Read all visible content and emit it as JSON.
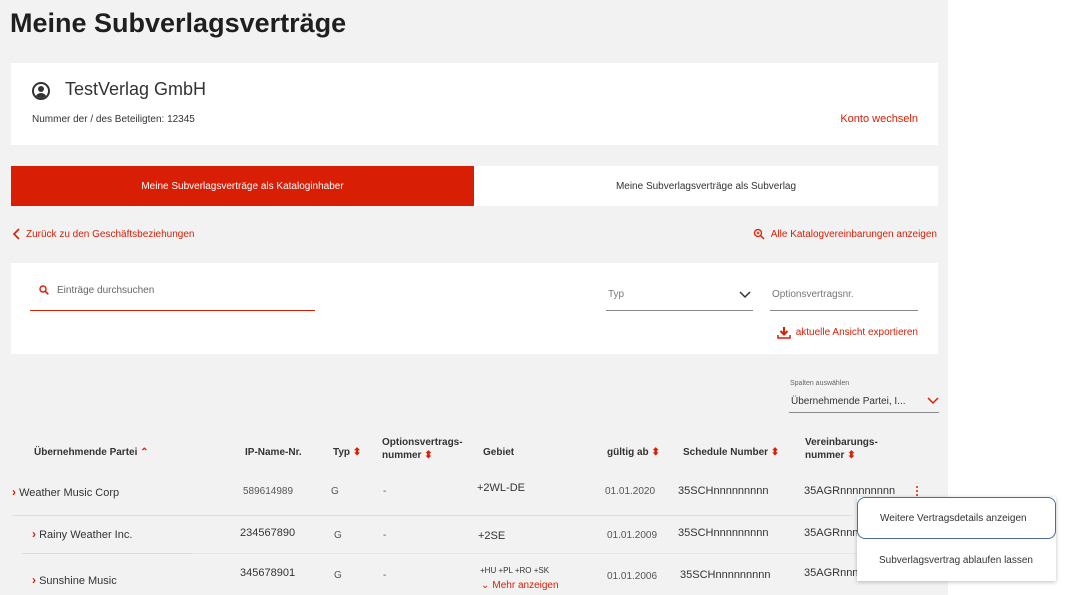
{
  "page": {
    "title": "Meine Subverlagsverträge"
  },
  "account": {
    "name": "TestVerlag GmbH",
    "number_label": "Nummer der / des Beteiligten:",
    "number_value": "12345",
    "switch_label": "Konto wechseln"
  },
  "tabs": [
    {
      "label": "Meine Subverlagsverträge als Kataloginhaber",
      "active": true
    },
    {
      "label": "Meine Subverlagsverträge als Subverlag",
      "active": false
    }
  ],
  "nav": {
    "back_label": "Zurück zu den Geschäftsbeziehungen",
    "catalog_label": "Alle Katalogvereinbarungen anzeigen"
  },
  "filters": {
    "search_placeholder": "Einträge durchsuchen",
    "typ_placeholder": "Typ",
    "option_placeholder": "Optionsvertragsnr.",
    "export_label": "aktuelle Ansicht exportieren"
  },
  "column_select": {
    "label": "Spalten auswählen",
    "value": "Übernehmende Partei, I..."
  },
  "table": {
    "headers": {
      "party": "Übernehmende Partei",
      "ip": "IP-Name-Nr.",
      "typ": "Typ",
      "option_line1": "Optionsvertrags-",
      "option_line2": "nummer",
      "region": "Gebiet",
      "valid": "gültig ab",
      "schedule": "Schedule Number",
      "agreement_line1": "Vereinbarungs-",
      "agreement_line2": "nummer"
    },
    "rows": [
      {
        "party": "Weather Music Corp",
        "ip": "589614989",
        "typ": "G",
        "option": "-",
        "region": "+2WL-DE",
        "valid": "01.01.2020",
        "schedule": "35SCHnnnnnnnnn",
        "agreement": "35AGRnnnnnnnnn"
      },
      {
        "party": "Rainy Weather Inc.",
        "ip": "234567890",
        "typ": "G",
        "option": "-",
        "region": "+2SE",
        "valid": "01.01.2009",
        "schedule": "35SCHnnnnnnnnn",
        "agreement": "35AGRnnnn"
      },
      {
        "party": "Sunshine Music",
        "ip": "345678901",
        "typ": "G",
        "option": "-",
        "region": "+HU +PL +RO +SK",
        "valid": "01.01.2006",
        "schedule": "35SCHnnnnnnnnn",
        "agreement": "35AGRnnnn"
      }
    ],
    "more_label": "Mehr anzeigen"
  },
  "context_menu": {
    "items": [
      "Weitere Vertragsdetails anzeigen",
      "Subverlagsvertrag ablaufen lassen"
    ]
  },
  "colors": {
    "accent": "#d81e05",
    "background": "#f2f2f2"
  }
}
